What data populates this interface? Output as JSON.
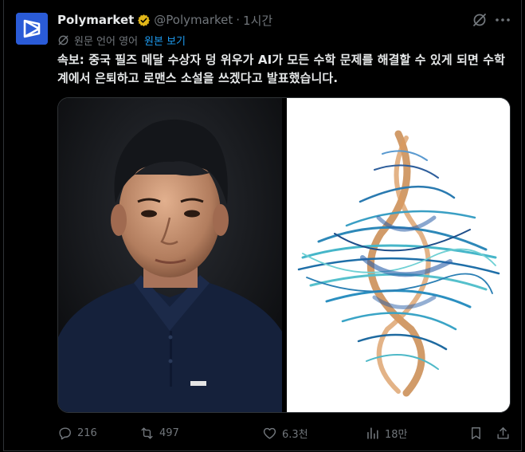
{
  "account": {
    "display_name": "Polymarket",
    "handle": "@Polymarket",
    "time": "1시간",
    "verified": true
  },
  "translation": {
    "label": "원문 언어 영어",
    "link": "원본 보기"
  },
  "tweet": {
    "text": "속보: 중국 필즈 메달 수상자 덩 위우가 AI가 모든 수학 문제를 해결할 수 있게 되면 수학계에서 은퇴하고 로맨스 소설을 쓰겠다고 발표했습니다."
  },
  "media": [
    {
      "kind": "photo",
      "icon": "portrait-photo"
    },
    {
      "kind": "photo",
      "icon": "abstract-helix-illustration"
    }
  ],
  "actions": {
    "replies": "216",
    "reposts": "497",
    "likes": "6.3천",
    "views": "18만"
  },
  "colors": {
    "background": "#000000",
    "text": "#e7e9ea",
    "muted": "#71767b",
    "link": "#1d9bf0",
    "avatar": "#2a5bd7",
    "verified_badge": "#e2b719"
  }
}
